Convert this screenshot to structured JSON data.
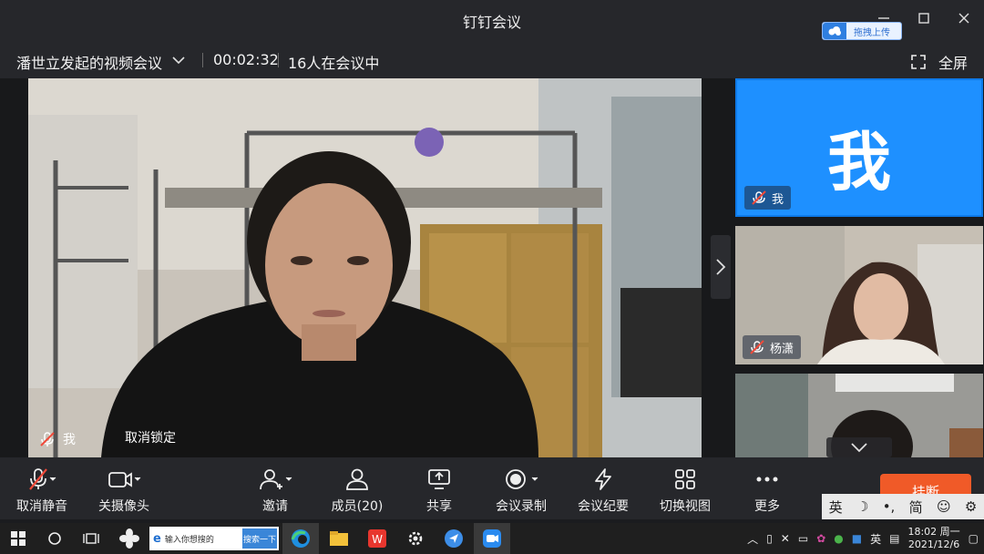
{
  "window": {
    "title": "钉钉会议",
    "upload_chip": "拖拽上传"
  },
  "info": {
    "meeting_name": "潘世立发起的视频会议",
    "duration": "00:02:32",
    "participants_text": "16人在会议中",
    "fullscreen_label": "全屏"
  },
  "stage": {
    "main_participant": "我",
    "unlock_label": "取消锁定",
    "tiles": [
      {
        "name": "我",
        "avatar_text": "我"
      },
      {
        "name": "杨潇"
      },
      {
        "name": ""
      }
    ]
  },
  "toolbar": {
    "items": [
      {
        "label": "取消静音",
        "icon": "mic-muted-icon"
      },
      {
        "label": "关摄像头",
        "icon": "camera-icon"
      },
      {
        "label": "邀请",
        "icon": "add-user-icon"
      },
      {
        "label": "成员(20)",
        "icon": "members-icon"
      },
      {
        "label": "共享",
        "icon": "share-screen-icon"
      },
      {
        "label": "会议录制",
        "icon": "record-icon"
      },
      {
        "label": "会议纪要",
        "icon": "notes-icon"
      },
      {
        "label": "切换视图",
        "icon": "grid-view-icon"
      },
      {
        "label": "更多",
        "icon": "more-icon"
      }
    ],
    "hangup_label": "挂断"
  },
  "ime": {
    "lang": "英",
    "mode": "简"
  },
  "taskbar": {
    "search_placeholder": "输入你想搜的",
    "search_button": "搜索一下",
    "tray_lang": "英",
    "time": "18:02 周一",
    "date": "2021/12/6"
  },
  "colors": {
    "accent_blue": "#1e90ff",
    "hangup": "#f05a28",
    "toolbar_bg": "#26272b"
  }
}
